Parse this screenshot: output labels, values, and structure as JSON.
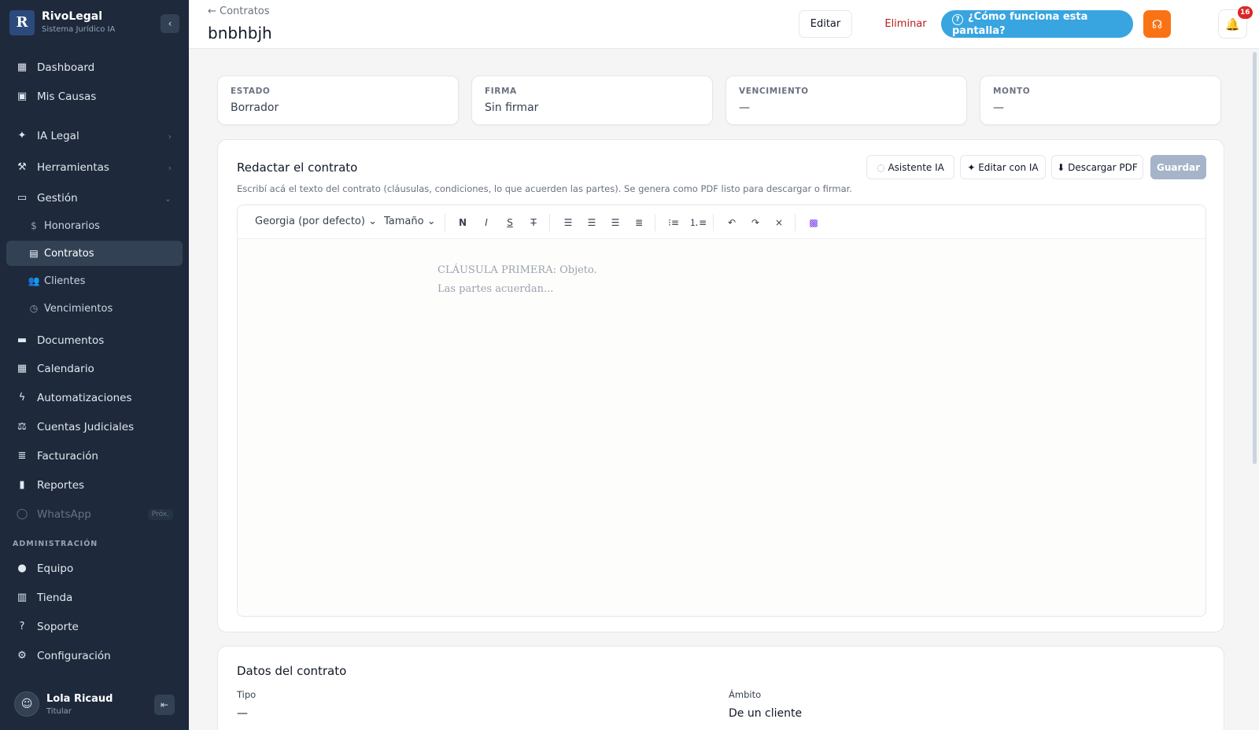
{
  "brand": {
    "logo": "R",
    "name": "RivoLegal",
    "subtitle": "Sistema Jurídico IA"
  },
  "sidebar": {
    "items": [
      {
        "label": "Dashboard"
      },
      {
        "label": "Mis Causas"
      },
      {
        "label": "IA Legal"
      },
      {
        "label": "Herramientas"
      },
      {
        "label": "Gestión"
      },
      {
        "label": "Honorarios"
      },
      {
        "label": "Contratos"
      },
      {
        "label": "Clientes"
      },
      {
        "label": "Vencimientos"
      },
      {
        "label": "Documentos"
      },
      {
        "label": "Calendario"
      },
      {
        "label": "Automatizaciones"
      },
      {
        "label": "Cuentas Judiciales"
      },
      {
        "label": "Facturación"
      },
      {
        "label": "Reportes"
      },
      {
        "label": "WhatsApp",
        "badge": "Próx."
      }
    ],
    "admin_title": "ADMINISTRACIÓN",
    "admin_items": [
      {
        "label": "Equipo"
      },
      {
        "label": "Tienda"
      },
      {
        "label": "Soporte"
      },
      {
        "label": "Configuración"
      }
    ]
  },
  "user": {
    "name": "Lola Ricaud",
    "role": "Titular"
  },
  "header": {
    "back_label": "← Contratos",
    "title": "bnbhbjh",
    "edit_label": "Editar",
    "delete_label": "Eliminar",
    "help_label": "¿Cómo funciona esta pantalla?",
    "notifications_count": "16"
  },
  "stats": [
    {
      "label": "ESTADO",
      "value": "Borrador"
    },
    {
      "label": "FIRMA",
      "value": "Sin firmar"
    },
    {
      "label": "VENCIMIENTO",
      "value": "—"
    },
    {
      "label": "MONTO",
      "value": "—"
    }
  ],
  "editor": {
    "title": "Redactar el contrato",
    "description": "Escribí acá el texto del contrato (cláusulas, condiciones, lo que acuerden las partes). Se genera como PDF listo para descargar o firmar.",
    "assistant_label": "Asistente IA",
    "edit_ai_label": "✦ Editar con IA",
    "download_label": "⬇ Descargar PDF",
    "save_label": "Guardar",
    "font_select": "Georgia (por defecto)",
    "size_select": "Tamaño",
    "bold": "N",
    "italic": "I",
    "underline": "S",
    "strike": "T",
    "placeholder_line1": "CLÁUSULA PRIMERA: Objeto.",
    "placeholder_line2": "Las partes acuerdan..."
  },
  "contract_data": {
    "title": "Datos del contrato",
    "type_label": "Tipo",
    "type_value": "—",
    "scope_label": "Ámbito",
    "scope_value": "De un cliente"
  },
  "colors": {
    "sidebar_bg": "#1e293b",
    "help_button": "#38a5e0",
    "support_button": "#f97316",
    "delete_text": "#b91c1c",
    "badge": "#dc2626"
  }
}
